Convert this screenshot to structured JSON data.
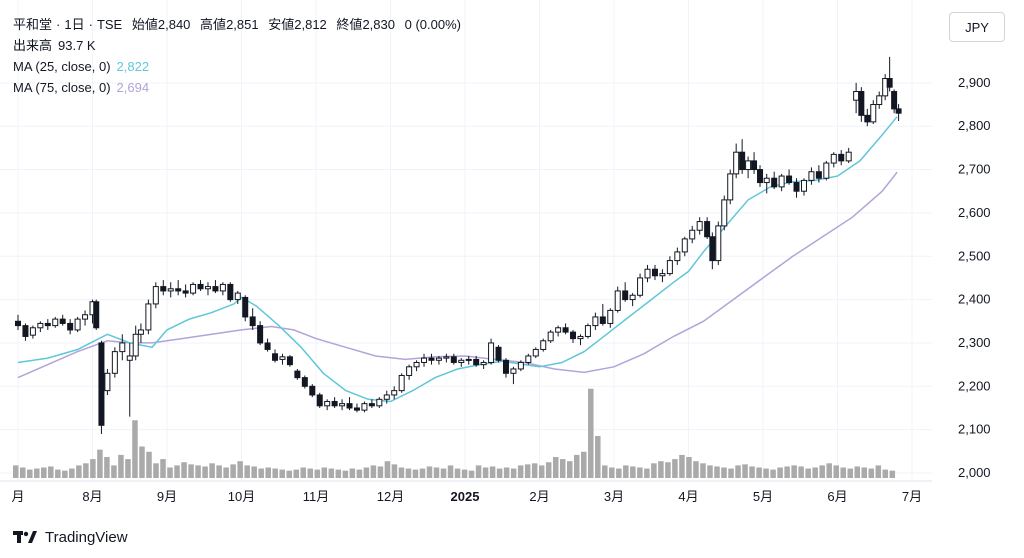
{
  "header": {
    "name": "平和堂",
    "interval": "1日",
    "exchange": "TSE",
    "open_label": "始値",
    "open": "2,840",
    "high_label": "高値",
    "high": "2,851",
    "low_label": "安値",
    "low": "2,812",
    "close_label": "終値",
    "close": "2,830",
    "change": "0 (0.00%)",
    "volume_label": "出来高",
    "volume": "93.7 K",
    "ma25_label": "MA (25, close, 0)",
    "ma25_value": "2,822",
    "ma75_label": "MA (75, close, 0)",
    "ma75_value": "2,694"
  },
  "currency": "JPY",
  "brand": "TradingView",
  "colors": {
    "up": "#ffffff",
    "down": "#131722",
    "ma25": "#5fc7d8",
    "ma75": "#b3a3d8",
    "volume": "#aaaaaa"
  },
  "chart_data": {
    "type": "candlestick",
    "yticks": [
      "2,000",
      "2,100",
      "2,200",
      "2,300",
      "2,400",
      "2,500",
      "2,600",
      "2,700",
      "2,800",
      "2,900"
    ],
    "ylim": [
      2000,
      2960
    ],
    "xticks": [
      "月",
      "8月",
      "9月",
      "10月",
      "11月",
      "12月",
      "2025",
      "2月",
      "3月",
      "4月",
      "5月",
      "6月",
      "7月"
    ],
    "xtick_month_index": [
      0,
      1,
      2,
      3,
      4,
      5,
      6,
      7,
      8,
      9,
      10,
      11,
      12
    ],
    "grid": true,
    "ma25": [
      [
        0,
        2255
      ],
      [
        0.4,
        2265
      ],
      [
        0.8,
        2285
      ],
      [
        1.2,
        2320
      ],
      [
        1.5,
        2300
      ],
      [
        1.8,
        2290
      ],
      [
        2.0,
        2330
      ],
      [
        2.3,
        2355
      ],
      [
        2.6,
        2370
      ],
      [
        2.9,
        2390
      ],
      [
        3.0,
        2405
      ],
      [
        3.2,
        2385
      ],
      [
        3.5,
        2340
      ],
      [
        3.8,
        2290
      ],
      [
        4.1,
        2230
      ],
      [
        4.4,
        2190
      ],
      [
        4.7,
        2170
      ],
      [
        5.0,
        2165
      ],
      [
        5.3,
        2190
      ],
      [
        5.6,
        2220
      ],
      [
        5.9,
        2240
      ],
      [
        6.2,
        2250
      ],
      [
        6.5,
        2258
      ],
      [
        6.8,
        2250
      ],
      [
        7.0,
        2245
      ],
      [
        7.3,
        2255
      ],
      [
        7.6,
        2280
      ],
      [
        7.9,
        2320
      ],
      [
        8.2,
        2360
      ],
      [
        8.5,
        2400
      ],
      [
        8.8,
        2440
      ],
      [
        9.0,
        2465
      ],
      [
        9.2,
        2510
      ],
      [
        9.5,
        2570
      ],
      [
        9.8,
        2630
      ],
      [
        10.1,
        2660
      ],
      [
        10.4,
        2672
      ],
      [
        10.7,
        2675
      ],
      [
        11.0,
        2685
      ],
      [
        11.3,
        2720
      ],
      [
        11.6,
        2780
      ],
      [
        11.8,
        2822
      ]
    ],
    "ma75": [
      [
        0,
        2220
      ],
      [
        0.4,
        2250
      ],
      [
        0.8,
        2280
      ],
      [
        1.2,
        2305
      ],
      [
        1.5,
        2300
      ],
      [
        1.8,
        2300
      ],
      [
        2.2,
        2310
      ],
      [
        2.6,
        2320
      ],
      [
        3.0,
        2330
      ],
      [
        3.4,
        2338
      ],
      [
        3.7,
        2330
      ],
      [
        4.0,
        2310
      ],
      [
        4.4,
        2290
      ],
      [
        4.8,
        2270
      ],
      [
        5.2,
        2262
      ],
      [
        5.6,
        2268
      ],
      [
        6.0,
        2270
      ],
      [
        6.4,
        2262
      ],
      [
        6.8,
        2255
      ],
      [
        7.2,
        2240
      ],
      [
        7.6,
        2232
      ],
      [
        8.0,
        2245
      ],
      [
        8.4,
        2275
      ],
      [
        8.8,
        2315
      ],
      [
        9.2,
        2350
      ],
      [
        9.6,
        2400
      ],
      [
        10.0,
        2450
      ],
      [
        10.4,
        2500
      ],
      [
        10.8,
        2545
      ],
      [
        11.2,
        2590
      ],
      [
        11.6,
        2650
      ],
      [
        11.8,
        2694
      ]
    ],
    "candles": [
      [
        0.0,
        2350,
        2365,
        2330,
        2340
      ],
      [
        0.1,
        2340,
        2345,
        2305,
        2315
      ],
      [
        0.2,
        2318,
        2340,
        2310,
        2335
      ],
      [
        0.3,
        2335,
        2350,
        2325,
        2345
      ],
      [
        0.4,
        2345,
        2355,
        2330,
        2340
      ],
      [
        0.5,
        2340,
        2360,
        2335,
        2355
      ],
      [
        0.6,
        2355,
        2365,
        2340,
        2345
      ],
      [
        0.7,
        2345,
        2355,
        2320,
        2330
      ],
      [
        0.8,
        2330,
        2360,
        2325,
        2355
      ],
      [
        0.9,
        2355,
        2375,
        2340,
        2365
      ],
      [
        1.0,
        2365,
        2400,
        2345,
        2395
      ],
      [
        1.05,
        2395,
        2400,
        2330,
        2335
      ],
      [
        1.12,
        2300,
        2305,
        2090,
        2110
      ],
      [
        1.2,
        2190,
        2240,
        2180,
        2230
      ],
      [
        1.3,
        2230,
        2290,
        2220,
        2280
      ],
      [
        1.4,
        2280,
        2320,
        2260,
        2300
      ],
      [
        1.5,
        2260,
        2300,
        2130,
        2270
      ],
      [
        1.58,
        2270,
        2340,
        2260,
        2320
      ],
      [
        1.65,
        2320,
        2345,
        2300,
        2330
      ],
      [
        1.75,
        2330,
        2400,
        2320,
        2390
      ],
      [
        1.85,
        2390,
        2440,
        2380,
        2430
      ],
      [
        1.95,
        2430,
        2445,
        2410,
        2420
      ],
      [
        2.05,
        2420,
        2440,
        2405,
        2425
      ],
      [
        2.15,
        2425,
        2445,
        2410,
        2420
      ],
      [
        2.25,
        2420,
        2435,
        2405,
        2415
      ],
      [
        2.35,
        2415,
        2440,
        2410,
        2435
      ],
      [
        2.45,
        2435,
        2445,
        2420,
        2425
      ],
      [
        2.55,
        2425,
        2440,
        2410,
        2430
      ],
      [
        2.65,
        2430,
        2445,
        2415,
        2420
      ],
      [
        2.75,
        2420,
        2440,
        2410,
        2435
      ],
      [
        2.85,
        2435,
        2440,
        2395,
        2400
      ],
      [
        2.95,
        2400,
        2420,
        2390,
        2415
      ],
      [
        3.05,
        2405,
        2410,
        2350,
        2360
      ],
      [
        3.15,
        2360,
        2380,
        2330,
        2340
      ],
      [
        3.25,
        2340,
        2350,
        2295,
        2300
      ],
      [
        3.35,
        2300,
        2310,
        2280,
        2285
      ],
      [
        3.45,
        2275,
        2285,
        2255,
        2260
      ],
      [
        3.55,
        2262,
        2275,
        2250,
        2268
      ],
      [
        3.65,
        2268,
        2272,
        2245,
        2250
      ],
      [
        3.75,
        2235,
        2240,
        2215,
        2220
      ],
      [
        3.85,
        2220,
        2225,
        2195,
        2200
      ],
      [
        3.95,
        2200,
        2205,
        2175,
        2180
      ],
      [
        4.05,
        2180,
        2185,
        2150,
        2155
      ],
      [
        4.15,
        2155,
        2170,
        2145,
        2165
      ],
      [
        4.25,
        2165,
        2175,
        2150,
        2155
      ],
      [
        4.35,
        2155,
        2170,
        2145,
        2160
      ],
      [
        4.45,
        2160,
        2175,
        2145,
        2150
      ],
      [
        4.55,
        2150,
        2160,
        2140,
        2145
      ],
      [
        4.65,
        2145,
        2165,
        2140,
        2160
      ],
      [
        4.75,
        2160,
        2170,
        2150,
        2155
      ],
      [
        4.85,
        2155,
        2175,
        2150,
        2170
      ],
      [
        4.95,
        2170,
        2190,
        2160,
        2180
      ],
      [
        5.05,
        2180,
        2200,
        2170,
        2190
      ],
      [
        5.15,
        2190,
        2230,
        2185,
        2225
      ],
      [
        5.25,
        2225,
        2250,
        2215,
        2245
      ],
      [
        5.35,
        2245,
        2260,
        2235,
        2255
      ],
      [
        5.45,
        2255,
        2275,
        2245,
        2265
      ],
      [
        5.55,
        2265,
        2275,
        2250,
        2260
      ],
      [
        5.65,
        2260,
        2270,
        2250,
        2265
      ],
      [
        5.75,
        2265,
        2275,
        2255,
        2268
      ],
      [
        5.85,
        2268,
        2275,
        2250,
        2255
      ],
      [
        5.95,
        2255,
        2265,
        2245,
        2260
      ],
      [
        6.05,
        2260,
        2270,
        2250,
        2262
      ],
      [
        6.15,
        2262,
        2270,
        2245,
        2250
      ],
      [
        6.25,
        2250,
        2260,
        2240,
        2255
      ],
      [
        6.35,
        2255,
        2310,
        2250,
        2300
      ],
      [
        6.45,
        2290,
        2295,
        2255,
        2260
      ],
      [
        6.55,
        2260,
        2265,
        2220,
        2230
      ],
      [
        6.65,
        2230,
        2245,
        2205,
        2240
      ],
      [
        6.75,
        2240,
        2260,
        2235,
        2255
      ],
      [
        6.85,
        2255,
        2275,
        2250,
        2270
      ],
      [
        6.95,
        2270,
        2290,
        2265,
        2285
      ],
      [
        7.05,
        2285,
        2310,
        2280,
        2305
      ],
      [
        7.15,
        2305,
        2330,
        2300,
        2325
      ],
      [
        7.25,
        2325,
        2340,
        2315,
        2335
      ],
      [
        7.35,
        2335,
        2345,
        2320,
        2325
      ],
      [
        7.45,
        2325,
        2330,
        2300,
        2310
      ],
      [
        7.55,
        2310,
        2320,
        2295,
        2315
      ],
      [
        7.65,
        2315,
        2345,
        2310,
        2340
      ],
      [
        7.75,
        2340,
        2370,
        2330,
        2360
      ],
      [
        7.85,
        2360,
        2390,
        2340,
        2345
      ],
      [
        7.95,
        2345,
        2380,
        2335,
        2375
      ],
      [
        8.05,
        2375,
        2430,
        2370,
        2420
      ],
      [
        8.15,
        2420,
        2440,
        2395,
        2400
      ],
      [
        8.25,
        2400,
        2415,
        2385,
        2410
      ],
      [
        8.35,
        2410,
        2460,
        2405,
        2450
      ],
      [
        8.45,
        2450,
        2480,
        2440,
        2470
      ],
      [
        8.55,
        2470,
        2480,
        2445,
        2455
      ],
      [
        8.65,
        2455,
        2470,
        2440,
        2460
      ],
      [
        8.75,
        2460,
        2500,
        2455,
        2490
      ],
      [
        8.85,
        2490,
        2520,
        2480,
        2510
      ],
      [
        8.95,
        2510,
        2545,
        2500,
        2540
      ],
      [
        9.05,
        2540,
        2570,
        2530,
        2560
      ],
      [
        9.15,
        2560,
        2590,
        2550,
        2580
      ],
      [
        9.25,
        2580,
        2590,
        2540,
        2545
      ],
      [
        9.32,
        2545,
        2555,
        2470,
        2490
      ],
      [
        9.4,
        2490,
        2580,
        2480,
        2570
      ],
      [
        9.48,
        2570,
        2640,
        2560,
        2630
      ],
      [
        9.56,
        2630,
        2700,
        2620,
        2690
      ],
      [
        9.64,
        2690,
        2760,
        2680,
        2740
      ],
      [
        9.72,
        2740,
        2770,
        2690,
        2700
      ],
      [
        9.8,
        2700,
        2730,
        2680,
        2720
      ],
      [
        9.88,
        2720,
        2740,
        2690,
        2700
      ],
      [
        9.96,
        2700,
        2710,
        2660,
        2670
      ],
      [
        10.05,
        2670,
        2690,
        2645,
        2680
      ],
      [
        10.15,
        2680,
        2695,
        2655,
        2660
      ],
      [
        10.25,
        2660,
        2690,
        2650,
        2685
      ],
      [
        10.35,
        2685,
        2700,
        2665,
        2670
      ],
      [
        10.45,
        2670,
        2680,
        2635,
        2650
      ],
      [
        10.55,
        2650,
        2680,
        2640,
        2675
      ],
      [
        10.65,
        2675,
        2705,
        2665,
        2695
      ],
      [
        10.75,
        2695,
        2710,
        2670,
        2680
      ],
      [
        10.85,
        2680,
        2720,
        2675,
        2715
      ],
      [
        10.95,
        2715,
        2740,
        2705,
        2735
      ],
      [
        11.05,
        2735,
        2745,
        2710,
        2720
      ],
      [
        11.15,
        2720,
        2750,
        2715,
        2740
      ],
      [
        11.25,
        2860,
        2900,
        2830,
        2880
      ],
      [
        11.32,
        2880,
        2890,
        2810,
        2825
      ],
      [
        11.4,
        2825,
        2840,
        2800,
        2810
      ],
      [
        11.48,
        2810,
        2860,
        2805,
        2850
      ],
      [
        11.56,
        2850,
        2880,
        2840,
        2870
      ],
      [
        11.64,
        2870,
        2920,
        2860,
        2910
      ],
      [
        11.7,
        2910,
        2960,
        2880,
        2890
      ],
      [
        11.76,
        2880,
        2885,
        2830,
        2840
      ],
      [
        11.82,
        2840,
        2851,
        2812,
        2830
      ]
    ],
    "volume": [
      12,
      10,
      8,
      9,
      10,
      11,
      8,
      7,
      9,
      12,
      14,
      18,
      27,
      20,
      12,
      22,
      18,
      55,
      30,
      25,
      14,
      18,
      10,
      12,
      15,
      13,
      12,
      11,
      14,
      12,
      10,
      13,
      16,
      12,
      11,
      9,
      10,
      9,
      8,
      7,
      8,
      10,
      9,
      8,
      10,
      9,
      8,
      7,
      9,
      8,
      10,
      12,
      11,
      16,
      13,
      10,
      9,
      8,
      9,
      11,
      10,
      9,
      12,
      9,
      8,
      7,
      12,
      10,
      11,
      9,
      10,
      9,
      12,
      13,
      14,
      12,
      15,
      20,
      18,
      16,
      22,
      25,
      85,
      40,
      12,
      10,
      9,
      12,
      11,
      10,
      9,
      14,
      16,
      15,
      18,
      22,
      20,
      16,
      14,
      12,
      11,
      10,
      9,
      12,
      13,
      11,
      10,
      9,
      8,
      10,
      11,
      12,
      11,
      9,
      10,
      12,
      14,
      12,
      10,
      9,
      11,
      10,
      9,
      12,
      8,
      7
    ]
  }
}
